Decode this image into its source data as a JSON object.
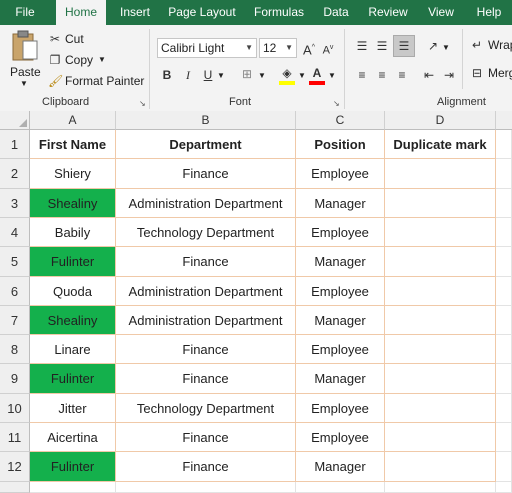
{
  "ribbon_tabs": [
    "File",
    "Home",
    "Insert",
    "Page Layout",
    "Formulas",
    "Data",
    "Review",
    "View",
    "Help"
  ],
  "active_tab": "Home",
  "clipboard": {
    "paste": "Paste",
    "cut": "Cut",
    "copy": "Copy",
    "format_painter": "Format Painter",
    "group": "Clipboard"
  },
  "font": {
    "name": "Calibri Light",
    "size": "12",
    "group": "Font",
    "bold": "B",
    "italic": "I",
    "underline": "U",
    "grow": "A",
    "shrink": "A",
    "fill_color": "#ffff00",
    "font_color": "#ff0000"
  },
  "alignment": {
    "wrap": "Wrap",
    "merge": "Merg",
    "group": "Alignment"
  },
  "columns": [
    "A",
    "B",
    "C",
    "D"
  ],
  "rows": [
    {
      "num": "1",
      "a": "First Name",
      "b": "Department",
      "c": "Position",
      "d": "Duplicate mark",
      "header": true,
      "green": false
    },
    {
      "num": "2",
      "a": "Shiery",
      "b": "Finance",
      "c": "Employee",
      "d": "",
      "header": false,
      "green": false
    },
    {
      "num": "3",
      "a": "Shealiny",
      "b": "Administration Department",
      "c": "Manager",
      "d": "",
      "header": false,
      "green": true
    },
    {
      "num": "4",
      "a": "Babily",
      "b": "Technology Department",
      "c": "Employee",
      "d": "",
      "header": false,
      "green": false
    },
    {
      "num": "5",
      "a": "Fulinter",
      "b": "Finance",
      "c": "Manager",
      "d": "",
      "header": false,
      "green": true
    },
    {
      "num": "6",
      "a": "Quoda",
      "b": "Administration Department",
      "c": "Employee",
      "d": "",
      "header": false,
      "green": false
    },
    {
      "num": "7",
      "a": "Shealiny",
      "b": "Administration Department",
      "c": "Manager",
      "d": "",
      "header": false,
      "green": true
    },
    {
      "num": "8",
      "a": "Linare",
      "b": "Finance",
      "c": "Employee",
      "d": "",
      "header": false,
      "green": false
    },
    {
      "num": "9",
      "a": "Fulinter",
      "b": "Finance",
      "c": "Manager",
      "d": "",
      "header": false,
      "green": true
    },
    {
      "num": "10",
      "a": "Jitter",
      "b": "Technology Department",
      "c": "Employee",
      "d": "",
      "header": false,
      "green": false
    },
    {
      "num": "11",
      "a": "Aicertina",
      "b": "Finance",
      "c": "Employee",
      "d": "",
      "header": false,
      "green": false
    },
    {
      "num": "12",
      "a": "Fulinter",
      "b": "Finance",
      "c": "Manager",
      "d": "",
      "header": false,
      "green": true
    }
  ],
  "highlight_color": "#14b04c",
  "theme_color": "#217346"
}
